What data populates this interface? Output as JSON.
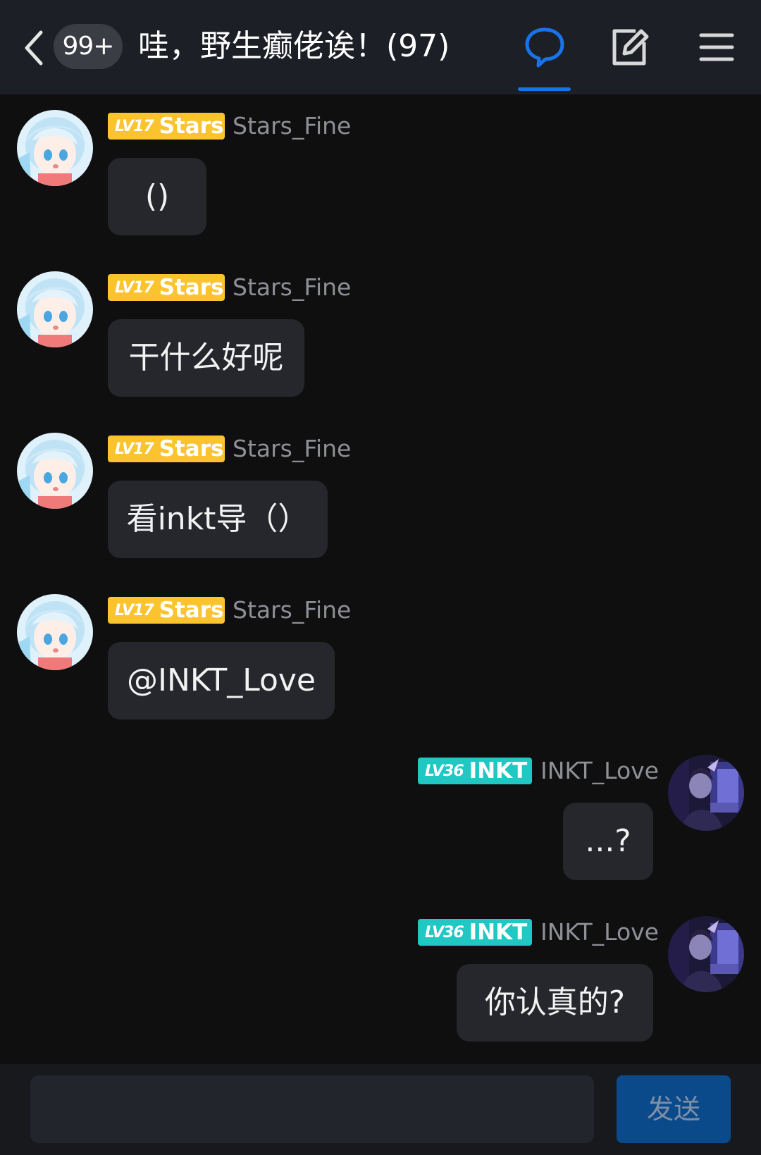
{
  "header": {
    "unread_count": "99+",
    "title": "哇，野生癫佬诶！(97)",
    "accent_color": "#1a73e8",
    "icons": [
      "back-arrow-icon",
      "chat-bubble-icon",
      "edit-icon",
      "menu-icon"
    ]
  },
  "messages": [
    {
      "side": "left",
      "level": "LV17",
      "badge_title": "Stars",
      "badge_color": "#fbc32d",
      "username": "Stars_Fine",
      "text": "()"
    },
    {
      "side": "left",
      "level": "LV17",
      "badge_title": "Stars",
      "badge_color": "#fbc32d",
      "username": "Stars_Fine",
      "text": "干什么好呢"
    },
    {
      "side": "left",
      "level": "LV17",
      "badge_title": "Stars",
      "badge_color": "#fbc32d",
      "username": "Stars_Fine",
      "text": "看inkt导（）"
    },
    {
      "side": "left",
      "level": "LV17",
      "badge_title": "Stars",
      "badge_color": "#fbc32d",
      "username": "Stars_Fine",
      "text": "@INKT_Love"
    },
    {
      "side": "right",
      "level": "LV36",
      "badge_title": "INKT",
      "badge_color": "#21c7c2",
      "username": "INKT_Love",
      "text": "...?"
    },
    {
      "side": "right",
      "level": "LV36",
      "badge_title": "INKT",
      "badge_color": "#21c7c2",
      "username": "INKT_Love",
      "text": "你认真的?"
    }
  ],
  "composer": {
    "input_value": "",
    "send_label": "发送"
  }
}
